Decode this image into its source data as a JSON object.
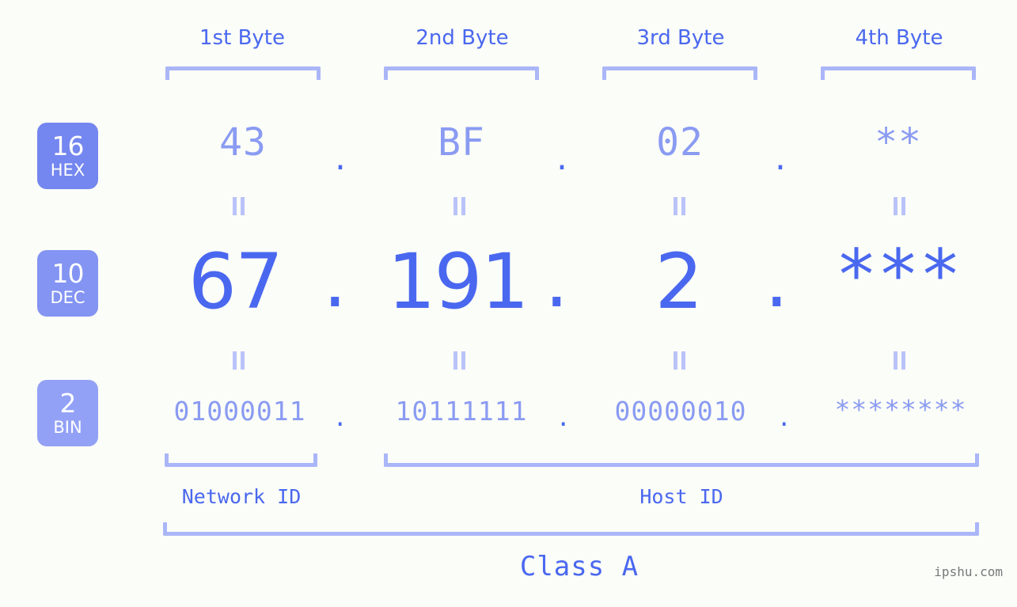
{
  "meta": {
    "watermark": "ipshu.com",
    "background_color": "#fbfdf8",
    "accent_color": "#4a68ef",
    "accent_light_color": "#8a9bf2",
    "bracket_color": "#aab6f8"
  },
  "byte_headers": [
    {
      "label": "1st Byte"
    },
    {
      "label": "2nd Byte"
    },
    {
      "label": "3rd Byte"
    },
    {
      "label": "4th Byte"
    }
  ],
  "radix_badges": [
    {
      "number": "16",
      "name": "HEX",
      "color": "#7486ef"
    },
    {
      "number": "10",
      "name": "DEC",
      "color": "#8394f2"
    },
    {
      "number": "2",
      "name": "BIN",
      "color": "#92a1f6"
    }
  ],
  "rows": {
    "hex": {
      "values": [
        "43",
        "BF",
        "02",
        "**"
      ],
      "separator": "."
    },
    "dec": {
      "values": [
        "67",
        "191",
        "2",
        "***"
      ],
      "separator": "."
    },
    "bin": {
      "values": [
        "01000011",
        "10111111",
        "00000010",
        "********"
      ],
      "separator": "."
    }
  },
  "equality_symbol": "=",
  "segments": [
    {
      "label": "Network ID"
    },
    {
      "label": "Host ID"
    }
  ],
  "class": {
    "label": "Class A"
  }
}
